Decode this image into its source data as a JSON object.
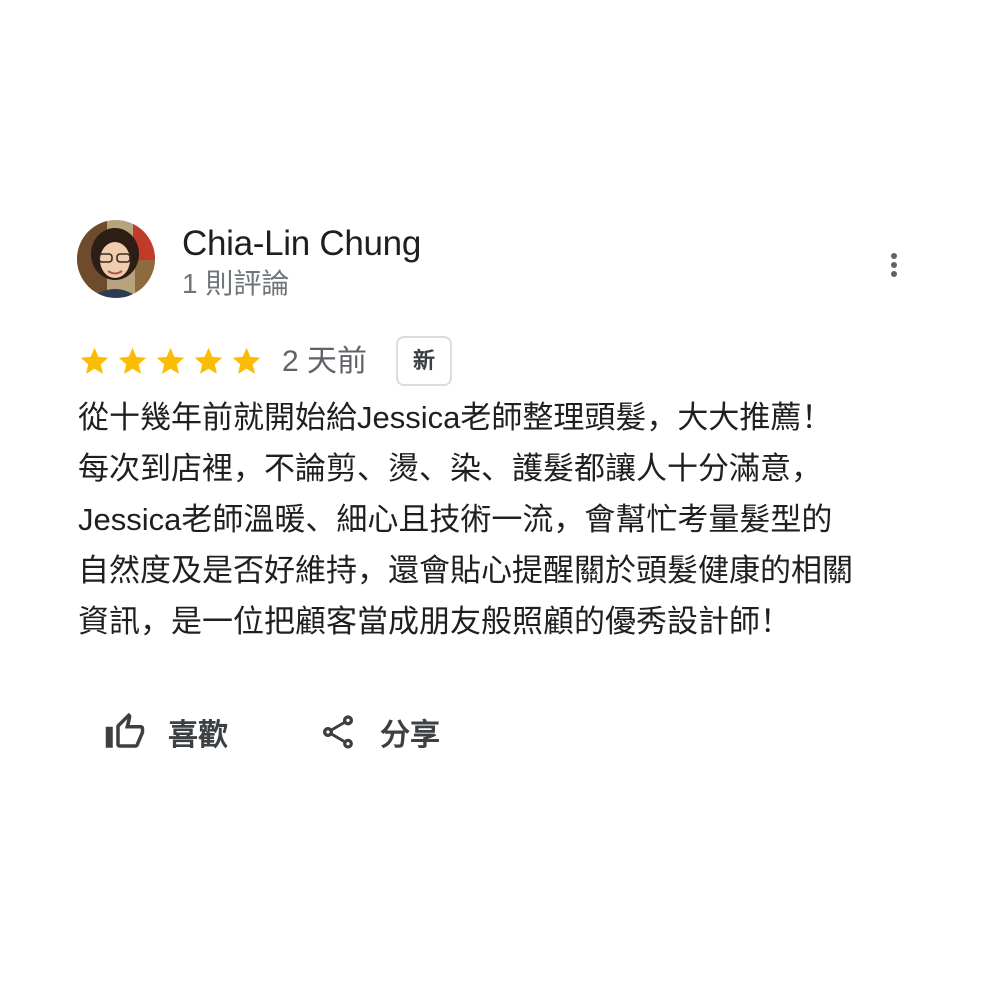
{
  "review": {
    "reviewer": {
      "name": "Chia-Lin Chung",
      "review_count": "1 則評論"
    },
    "rating": 5,
    "max_rating": 5,
    "time_ago": "2 天前",
    "badge": "新",
    "text_lines": [
      "從十幾年前就開始給Jessica老師整理頭髮，大大推薦！",
      "每次到店裡，不論剪、燙、染、護髮都讓人十分滿意，",
      "Jessica老師溫暖、細心且技術一流，會幫忙考量髮型的",
      "自然度及是否好維持，還會貼心提醒關於頭髮健康的相關",
      "資訊，是一位把顧客當成朋友般照顧的優秀設計師！"
    ]
  },
  "actions": {
    "like_label": "喜歡",
    "share_label": "分享"
  },
  "icons": {
    "more": "more-vert-icon",
    "like": "thumb-up-icon",
    "share": "share-icon",
    "star": "star-icon"
  },
  "colors": {
    "star": "#fbbc04",
    "secondary_text": "#70757a",
    "primary_text": "#1f1f1f",
    "badge_border": "#dadce0"
  }
}
